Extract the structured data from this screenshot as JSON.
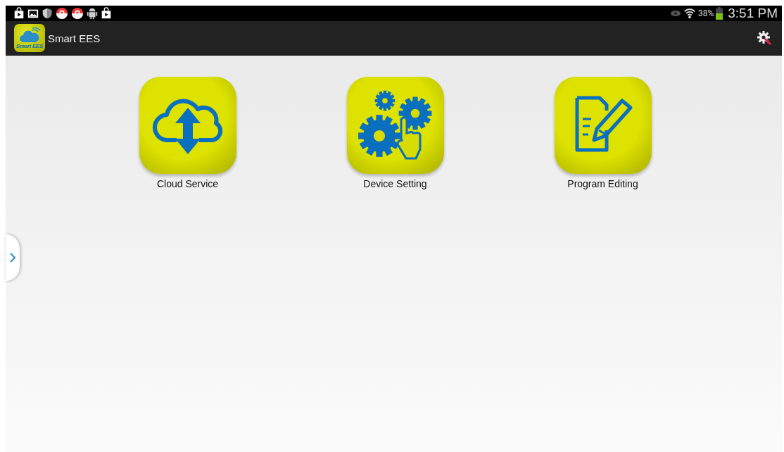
{
  "status_bar": {
    "battery_text": "38%",
    "time": "3:51 PM"
  },
  "app_bar": {
    "title": "Smart EES",
    "logo_text": "Smart EES"
  },
  "tiles": [
    {
      "kind": "cloud",
      "label": "Cloud Service"
    },
    {
      "kind": "gears",
      "label": "Device Setting"
    },
    {
      "kind": "document",
      "label": "Program Editing"
    }
  ]
}
